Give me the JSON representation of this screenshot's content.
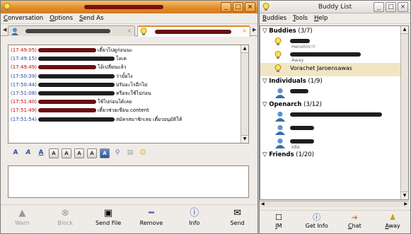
{
  "conversation": {
    "menu": [
      "Conversation",
      "Options",
      "Send As"
    ],
    "log": [
      {
        "time": "(17:49:05)",
        "color": "red",
        "text": "เดี๋ยวไปดูก่อนนะ"
      },
      {
        "time": "(17:49:15)",
        "color": "blue",
        "text": "โอเค"
      },
      {
        "time": "(17:49:49)",
        "color": "red",
        "text": "โอ้เปลี่ยนแล้ว"
      },
      {
        "time": "(17:50:39)",
        "color": "blue",
        "text": "ว่ามั้ยไง"
      },
      {
        "time": "(17:50:44)",
        "color": "blue",
        "text": "ปรับอะไรอีกไม่"
      },
      {
        "time": "(17:51:08)",
        "color": "blue",
        "text": "หรือจะใช้ไปก่อน"
      },
      {
        "time": "(17:51:40)",
        "color": "red",
        "text": "ใช้ไปก่อนได้เลย"
      },
      {
        "time": "(17:51:49)",
        "color": "red",
        "text": "เดี๋ยวช่วยเขียน content"
      },
      {
        "time": "(17:51:54)",
        "color": "blue",
        "text": "สมัครสมาชิกเลย เดี๋ยวอนุมัติให้"
      }
    ],
    "actions": [
      {
        "label": "Warn",
        "icon": "warn-icon",
        "enabled": false
      },
      {
        "label": "Block",
        "icon": "block-icon",
        "enabled": false
      },
      {
        "label": "Send File",
        "icon": "send-file-icon",
        "enabled": true
      },
      {
        "label": "Remove",
        "icon": "remove-icon",
        "enabled": true
      },
      {
        "label": "Info",
        "icon": "info-icon",
        "enabled": true
      },
      {
        "label": "Send",
        "icon": "send-icon",
        "enabled": true
      }
    ]
  },
  "buddy_list": {
    "title": "Buddy List",
    "menu": [
      "Buddies",
      "Tools",
      "Help"
    ],
    "groups": [
      {
        "name": "Buddies",
        "count": "(3/7)",
        "buddies": [
          {
            "status": "Henshin!!!"
          },
          {
            "status": "Away"
          },
          {
            "name": "Vorachet Jaroensawas",
            "selected": true
          }
        ]
      },
      {
        "name": "Individuals",
        "count": "(1/9)",
        "buddies": [
          {}
        ]
      },
      {
        "name": "Openarch",
        "count": "(3/12)",
        "buddies": [
          {},
          {},
          {
            "status": "Idle"
          }
        ]
      },
      {
        "name": "Friends",
        "count": "(1/20)",
        "buddies": []
      }
    ],
    "actions": [
      {
        "label": "IM",
        "icon": "im-icon"
      },
      {
        "label": "Get Info",
        "icon": "get-info-icon"
      },
      {
        "label": "Chat",
        "icon": "chat-icon"
      },
      {
        "label": "Away",
        "icon": "away-icon"
      }
    ]
  },
  "colors": {
    "accent": "#e38c2c",
    "timestamp_red": "#c00000",
    "timestamp_blue": "#2244aa"
  }
}
